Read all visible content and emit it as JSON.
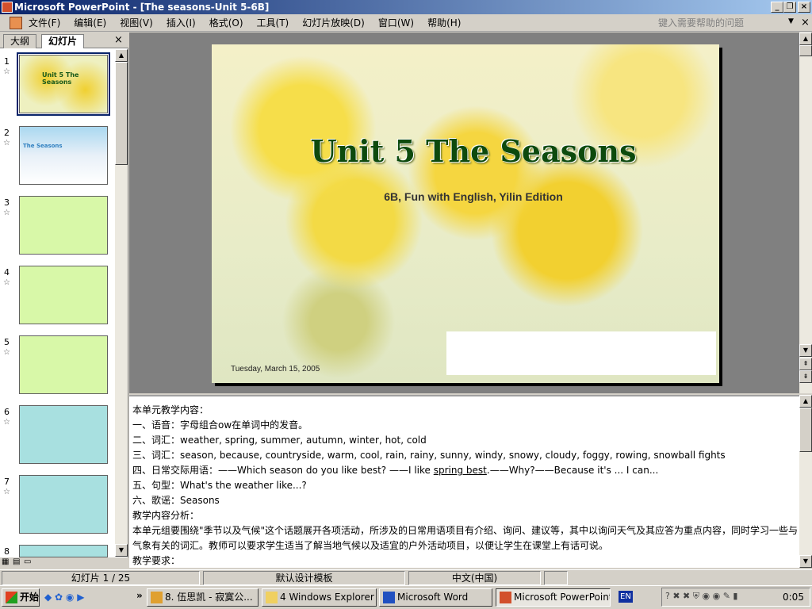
{
  "window": {
    "title": "Microsoft PowerPoint - [The seasons-Unit 5-6B]",
    "controls": [
      "_",
      "❐",
      "×"
    ]
  },
  "menu": [
    "文件(F)",
    "编辑(E)",
    "视图(V)",
    "插入(I)",
    "格式(O)",
    "工具(T)",
    "幻灯片放映(D)",
    "窗口(W)",
    "帮助(H)"
  ],
  "help_placeholder": "键入需要帮助的问题",
  "left_pane": {
    "tabs": [
      "大纲",
      "幻灯片"
    ],
    "close": "×",
    "slides": [
      "1",
      "2",
      "3",
      "4",
      "5",
      "6",
      "7",
      "8"
    ]
  },
  "slide": {
    "title": "Unit 5 The Seasons",
    "subtitle": "6B, Fun with English, Yilin Edition",
    "date": "Tuesday, March 15, 2005"
  },
  "notes": {
    "lines": [
      "本单元教学内容：",
      "一、语音：字母组合ow在单词中的发音。",
      "二、词汇：weather, spring, summer, autumn, winter, hot, cold",
      "三、词汇：season, because, countryside, warm, cool, rain, rainy, sunny, windy, snowy, cloudy, foggy, rowing, snowball fights"
    ],
    "line4_pre": "四、日常交际用语：——Which season do you like best? ——I like ",
    "line4_u": "spring best",
    "line4_post": ".——Why?——Because it's ... I can...",
    "lines2": [
      "五、句型：What's the weather like...?",
      "六、歌谣：Seasons",
      "教学内容分析：",
      "本单元组要围绕\"季节以及气候\"这个话题展开各项活动，所涉及的日常用语项目有介绍、询问、建议等，其中以询问天气及其应答为重点内容，同时学习一些与气象有关的词汇。教师可以要求学生适当了解当地气候以及适宜的户外活动项目，以便让学生在课堂上有话可说。",
      "教学要求："
    ]
  },
  "status": {
    "slide": "幻灯片 1 / 25",
    "template": "默认设计模板",
    "language": "中文(中国)"
  },
  "taskbar": {
    "start": "开始",
    "items": [
      "8. 伍思凯 - 寂寞公...",
      "4 Windows Explorer",
      "Microsoft Word",
      "Microsoft PowerPoint ..."
    ],
    "lang": "EN",
    "clock": "0:05"
  }
}
